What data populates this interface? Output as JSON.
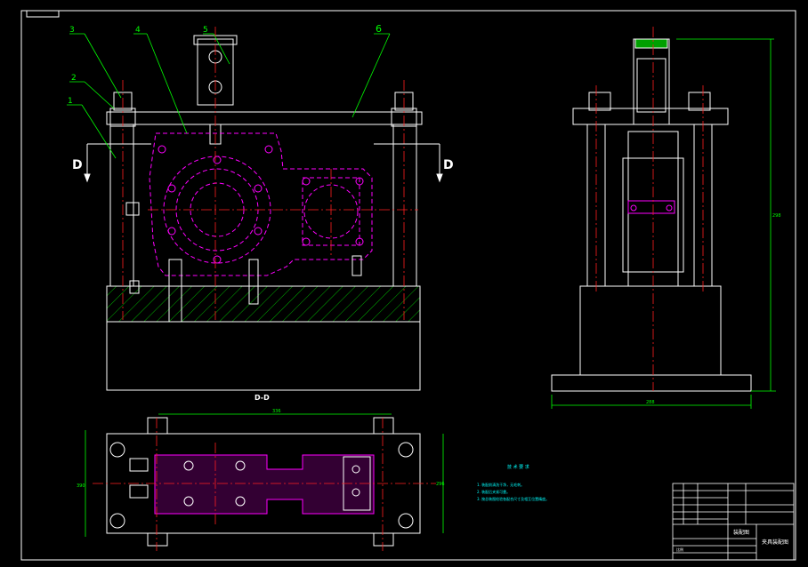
{
  "drawing": {
    "section_label": "D-D",
    "section_marker_left": "D",
    "section_marker_right": "D",
    "callouts": [
      "1",
      "2",
      "3",
      "4",
      "5",
      "6"
    ],
    "dim_top_width": "336",
    "dim_left_height": "390",
    "dim_right_height": "296",
    "dim_side_base": "288",
    "dim_side_height": "298",
    "notes_title": "技 术 要 求",
    "notes": [
      "1. 装配前清洗干净，无毛刺。",
      "2. 装配后夹紧可靠。",
      "3. 按总装图检验各配合尺寸及相互位置精度。"
    ],
    "title_block": {
      "drawing_name": "夹具装配图",
      "scale_label": "比例",
      "material": "装配图"
    }
  },
  "colors": {
    "background": "#000000",
    "frame": "#ffffff",
    "part": "#ffffff",
    "feature": "#ff00ff",
    "centerline": "#ff2020",
    "leader": "#00ff00",
    "hatch": "#00c000",
    "note": "#00ffff"
  }
}
